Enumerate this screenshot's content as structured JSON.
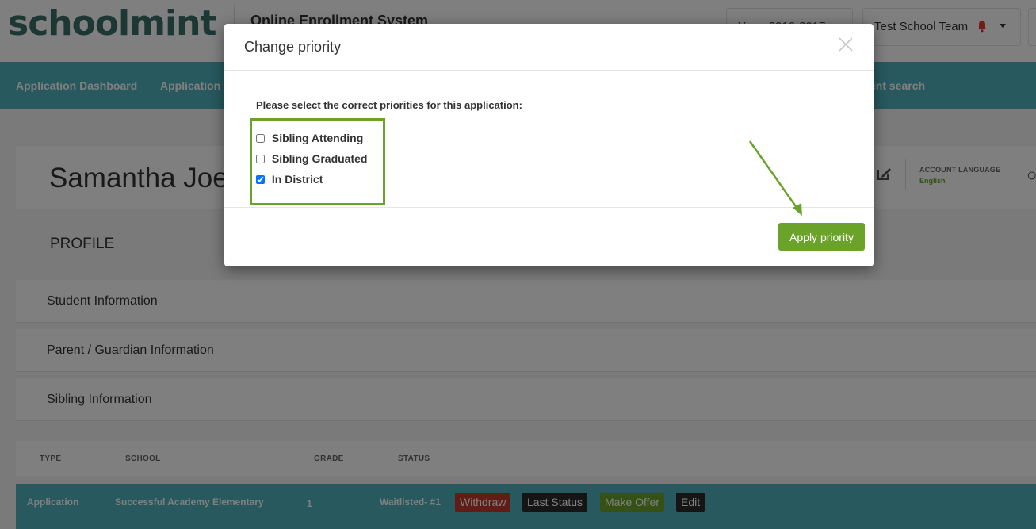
{
  "header": {
    "logo": "schoolmint",
    "app_title": "Online Enrollment System",
    "year_text": "Year: 2016-2017",
    "team_label": "Test School Team"
  },
  "nav": {
    "items": [
      {
        "label": "Application Dashboard"
      },
      {
        "label": "Application"
      },
      {
        "label": "ent search"
      }
    ]
  },
  "profile": {
    "name": "Samantha Joe",
    "account_language_label": "ACCOUNT LANGUAGE",
    "account_language_value": "English",
    "heading": "PROFILE",
    "sections": [
      {
        "label": "Student Information"
      },
      {
        "label": "Parent / Guardian Information"
      },
      {
        "label": "Sibling Information"
      }
    ]
  },
  "table": {
    "headers": [
      "TYPE",
      "SCHOOL",
      "GRADE",
      "STATUS"
    ],
    "row": {
      "type": "Application",
      "school": "Successful Academy Elementary",
      "grade": "1",
      "status": "Waitlisted- #1",
      "actions": [
        "Withdraw",
        "Last Status",
        "Make Offer",
        "Edit"
      ]
    }
  },
  "modal": {
    "title": "Change priority",
    "prompt": "Please select the correct priorities for this application:",
    "options": [
      {
        "label": "Sibling Attending",
        "checked": false
      },
      {
        "label": "Sibling Graduated",
        "checked": false
      },
      {
        "label": "In District",
        "checked": true
      }
    ],
    "apply_label": "Apply priority"
  },
  "colors": {
    "brand_green": "#6aa22a",
    "nav_teal": "#4eb3bd",
    "withdraw_red": "#c0392b",
    "dark_button": "#2b2b2b"
  }
}
